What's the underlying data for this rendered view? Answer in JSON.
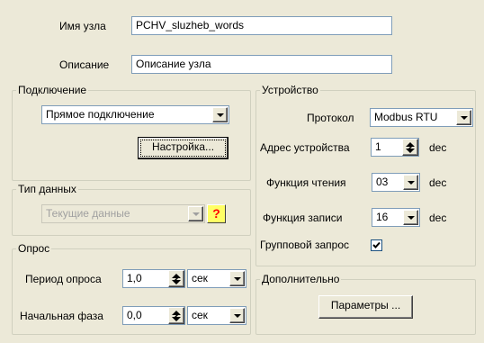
{
  "node": {
    "name_label": "Имя узла",
    "name_value": "PCHV_sluzheb_words",
    "desc_label": "Описание",
    "desc_value": "Описание узла"
  },
  "connection": {
    "title": "Подключение",
    "type_value": "Прямое подключение",
    "settings_button": "Настройка..."
  },
  "data_type": {
    "title": "Тип данных",
    "value": "Текущие данные",
    "help_glyph": "?"
  },
  "poll": {
    "title": "Опрос",
    "period_label": "Период опроса",
    "period_value": "1,0",
    "period_unit": "сек",
    "phase_label": "Начальная фаза",
    "phase_value": "0,0",
    "phase_unit": "сек"
  },
  "device": {
    "title": "Устройство",
    "protocol_label": "Протокол",
    "protocol_value": "Modbus RTU",
    "address_label": "Адрес устройства",
    "address_value": "1",
    "address_unit": "dec",
    "read_label": "Функция чтения",
    "read_value": "03",
    "read_unit": "dec",
    "write_label": "Функция записи",
    "write_value": "16",
    "write_unit": "dec",
    "group_label": "Групповой запрос",
    "group_checked": true
  },
  "extra": {
    "title": "Дополнительно",
    "params_button": "Параметры ..."
  },
  "colors": {
    "window_bg": "#ece9d8",
    "field_border": "#7f9db9",
    "help_bg": "#ffff66",
    "help_fg": "#ff0000"
  }
}
